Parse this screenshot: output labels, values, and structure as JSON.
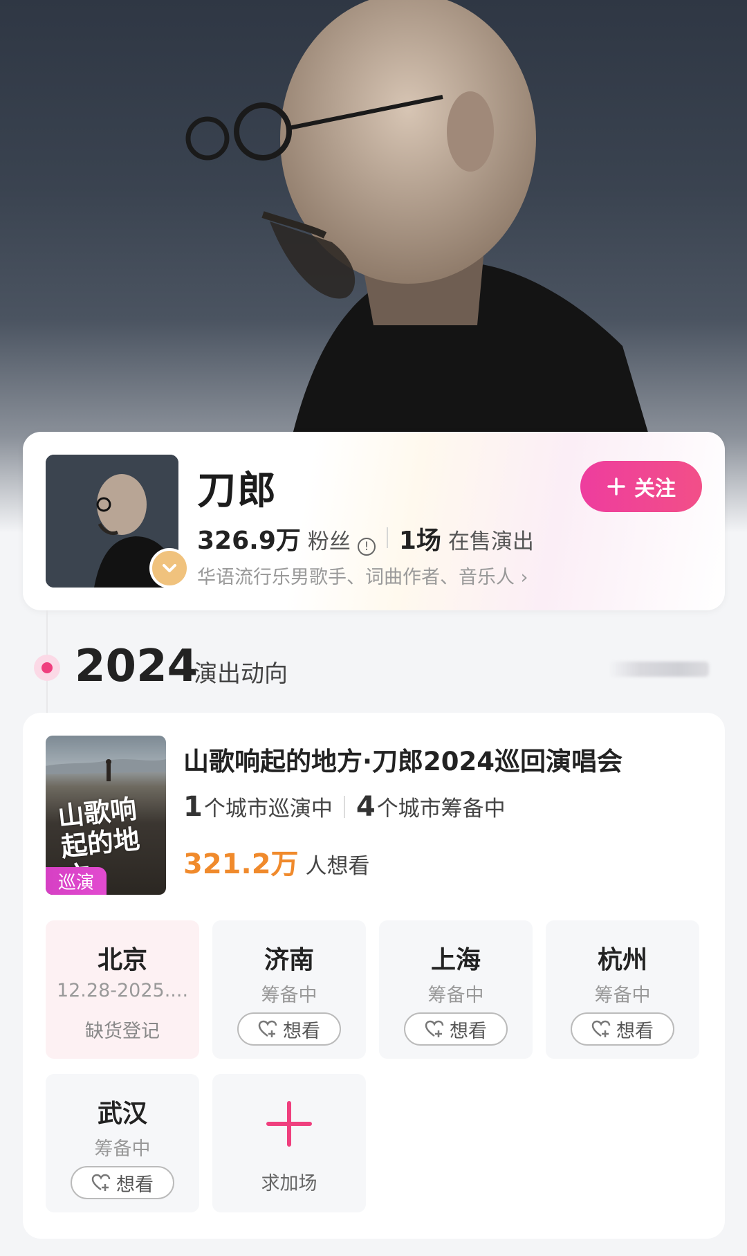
{
  "artist": {
    "name": "刀郎",
    "follow_label": "关注",
    "fans_count": "326.9万",
    "fans_label": "粉丝",
    "shows_count": "1场",
    "shows_label": "在售演出",
    "tags": "华语流行乐男歌手、词曲作者、音乐人 ›"
  },
  "timeline": {
    "year": "2024",
    "subtitle": "演出动向"
  },
  "show": {
    "title": "山歌响起的地方·刀郎2024巡回演唱会",
    "poster_text": "山歌响起的地方",
    "badge": "巡演",
    "touring_num": "1",
    "touring_text": "个城市巡演中",
    "prep_num": "4",
    "prep_text": "个城市筹备中",
    "want_count": "321.2万",
    "want_label": "人想看"
  },
  "cities": [
    {
      "name": "北京",
      "status": "12.28-2025....",
      "action": "缺货登记"
    },
    {
      "name": "济南",
      "status": "筹备中",
      "action": "想看"
    },
    {
      "name": "上海",
      "status": "筹备中",
      "action": "想看"
    },
    {
      "name": "杭州",
      "status": "筹备中",
      "action": "想看"
    },
    {
      "name": "武汉",
      "status": "筹备中",
      "action": "想看"
    }
  ],
  "add_show_label": "求加场",
  "colors": {
    "accent_pink": "#ef3f7e",
    "follow_gradient_start": "#ee3d9e",
    "want_orange": "#f08a2c",
    "badge_magenta": "#d640c4",
    "verified_gold": "#f0c27d"
  },
  "icons": [
    "plus-icon",
    "info-icon",
    "verified-badge-icon",
    "heart-plus-icon",
    "add-show-plus-icon"
  ]
}
